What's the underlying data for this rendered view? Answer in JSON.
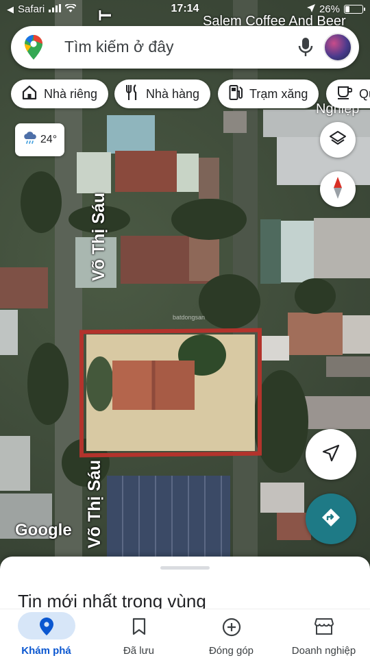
{
  "status_bar": {
    "carrier": "Safari",
    "time": "17:14",
    "battery": "26%",
    "battery_level": 0.26
  },
  "map": {
    "place_top": "Salem Coffee And Beer",
    "place_side": "Nghiệp",
    "road_label_upper": "Võ Thị Sáu",
    "road_label_lower": "Võ Thị Sáu",
    "road_label_top_partial": "T",
    "google_logo": "Google",
    "watermark": "batdongsan"
  },
  "search": {
    "placeholder": "Tìm kiếm ở đây",
    "pin_icon": "google-maps-pin-icon",
    "mic_icon": "microphone-icon"
  },
  "chips": [
    {
      "label": "Nhà riêng",
      "icon": "home-icon"
    },
    {
      "label": "Nhà hàng",
      "icon": "restaurant-icon"
    },
    {
      "label": "Trạm xăng",
      "icon": "gas-station-icon"
    },
    {
      "label": "Qu",
      "icon": "coffee-icon"
    }
  ],
  "weather": {
    "temp": "24°",
    "icon": "rain-cloud-icon"
  },
  "sheet": {
    "title": "Tin mới nhất trong vùng"
  },
  "nav": [
    {
      "label": "Khám phá",
      "icon": "explore-pin-icon",
      "active": true
    },
    {
      "label": "Đã lưu",
      "icon": "bookmark-icon",
      "active": false
    },
    {
      "label": "Đóng góp",
      "icon": "add-circle-icon",
      "active": false
    },
    {
      "label": "Doanh nghiệp",
      "icon": "storefront-icon",
      "active": false
    }
  ],
  "colors": {
    "accent_blue": "#1a73e8",
    "directions_teal": "#1e7a86",
    "plot_outline": "#b3332c",
    "compass_red": "#d93025"
  }
}
